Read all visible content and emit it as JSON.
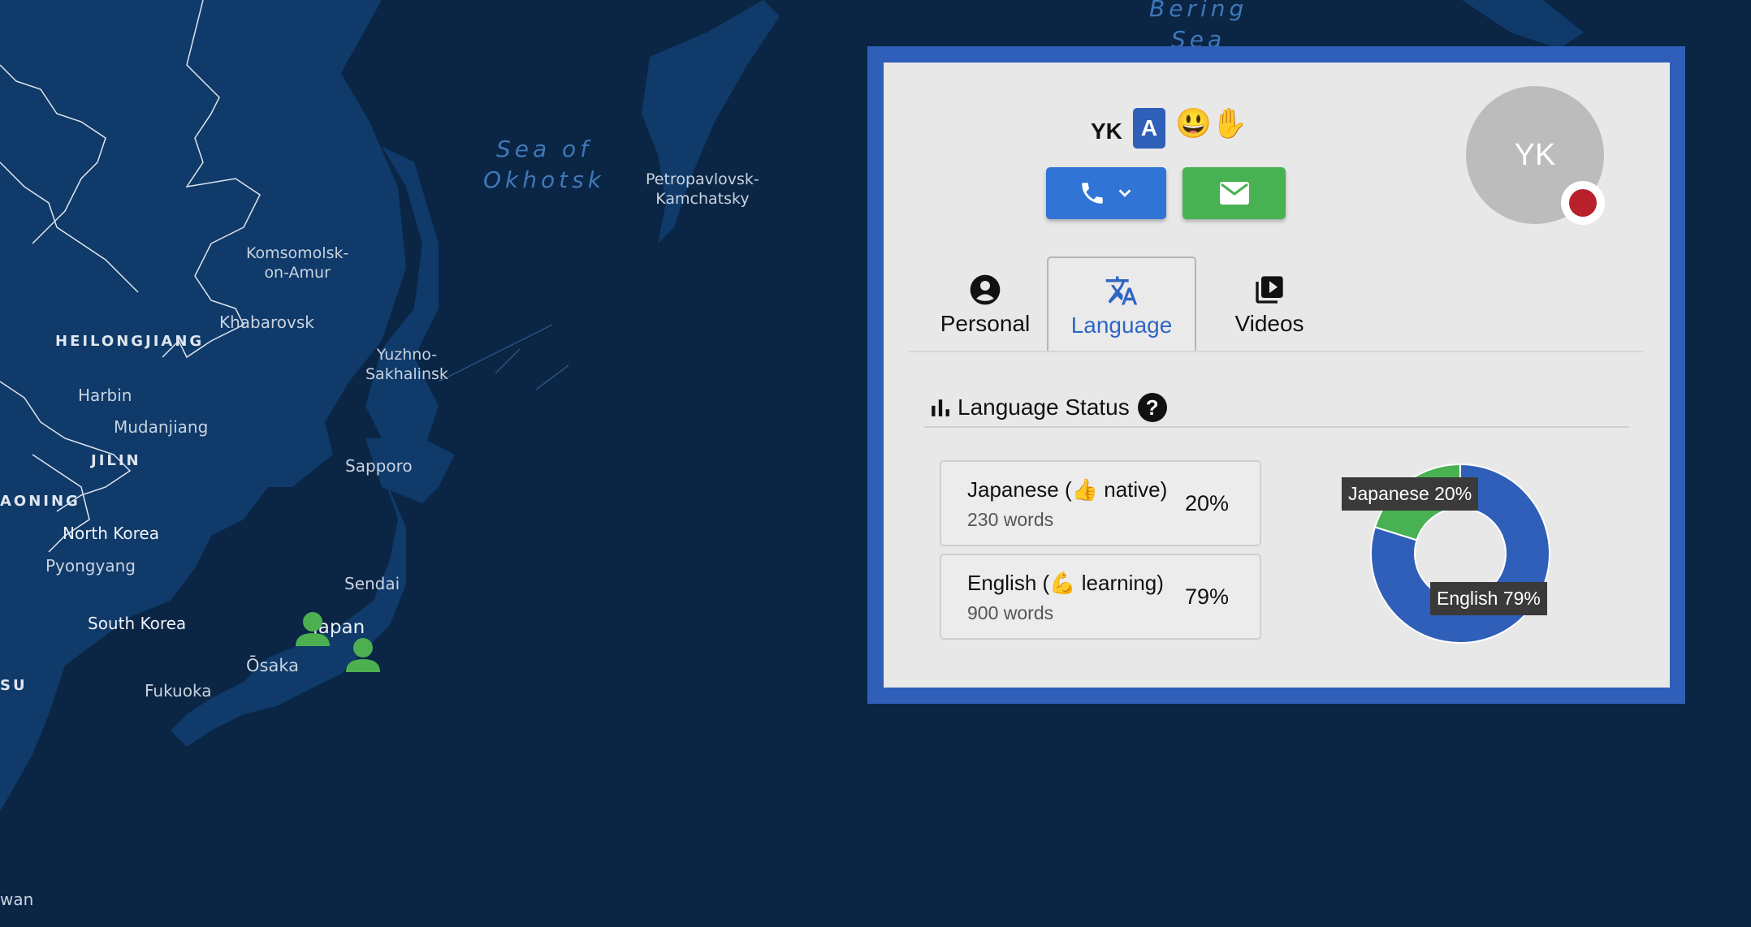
{
  "map": {
    "labels": {
      "bering_sea": "Bering\nSea",
      "sea_of_okhotsk": "Sea of\nOkhotsk",
      "petropavlovsk": "Petropavlovsk-\nKamchatsky",
      "komsomolsk": "Komsomolsk-\non-Amur",
      "khabarovsk": "Khabarovsk",
      "heilongjiang": "HEILONGJIANG",
      "yuzhno": "Yuzhno-\nSakhalinsk",
      "harbin": "Harbin",
      "mudanjiang": "Mudanjiang",
      "jilin": "JILIN",
      "liaoning": "AONING",
      "sapporo": "Sapporo",
      "north_korea": "North Korea",
      "pyongyang": "Pyongyang",
      "sendai": "Sendai",
      "south_korea": "South Korea",
      "japan": "Japan",
      "osaka": "Ōsaka",
      "fukuoka": "Fukuoka",
      "su": "SU",
      "taiwan": "wan"
    },
    "colors": {
      "ocean": "#0b2545",
      "land": "#0f3a6a",
      "marker": "#4caf50"
    }
  },
  "profile": {
    "initials": "YK",
    "level_badge": "A",
    "emojis": "😃✋",
    "avatar_initials": "YK",
    "call_button": {
      "icon": "phone-icon",
      "dropdown_icon": "chevron-down-icon"
    },
    "email_button": {
      "icon": "envelope-icon"
    },
    "status_color": "#b8202c"
  },
  "tabs": [
    {
      "label": "Personal",
      "icon": "account-circle-icon",
      "active": false
    },
    {
      "label": "Language",
      "icon": "translate-icon",
      "active": true
    },
    {
      "label": "Videos",
      "icon": "video-library-icon",
      "active": false
    }
  ],
  "language_status": {
    "title": "Language Status",
    "help": "?",
    "languages": [
      {
        "name": "Japanese (👍 native)",
        "words": "230 words",
        "percent": "20%"
      },
      {
        "name": "English (💪 learning)",
        "words": "900 words",
        "percent": "79%"
      }
    ]
  },
  "chart_data": {
    "type": "pie",
    "donut": true,
    "labels": [
      "Japanese",
      "English"
    ],
    "values": [
      20,
      79
    ],
    "data_labels": [
      "Japanese 20%",
      "English 79%"
    ],
    "colors": [
      "#48b152",
      "#2f5fb8"
    ]
  }
}
